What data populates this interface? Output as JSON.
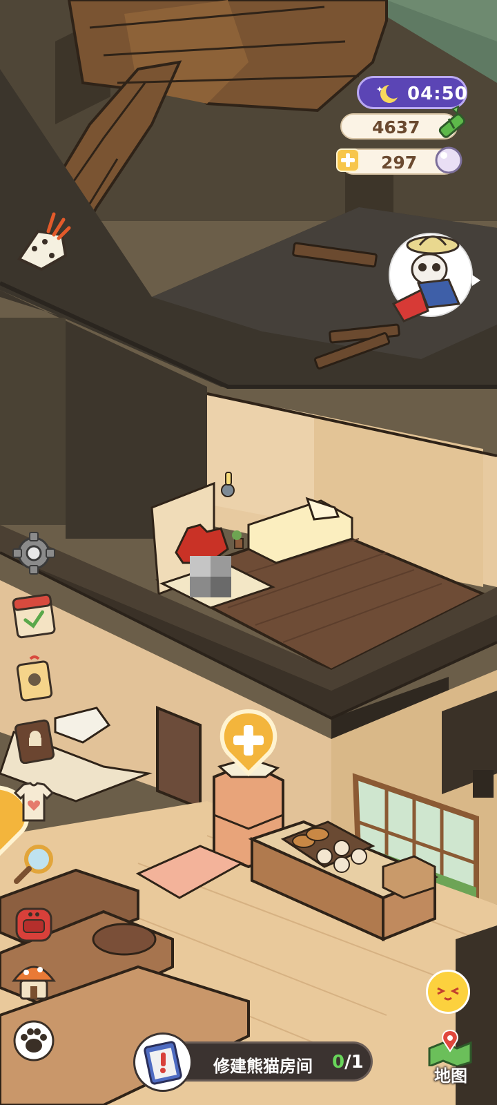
{
  "hud": {
    "time": "04:50",
    "bamboo_count": "4637",
    "pearl_count": "297"
  },
  "task": {
    "label": "修建熊猫房间",
    "done": "0",
    "total": "/1"
  },
  "map_button": {
    "label": "地图"
  },
  "sidebar": [
    {
      "icon": "settings-gear-icon"
    },
    {
      "icon": "calendar-icon"
    },
    {
      "icon": "ticket-tag-icon"
    },
    {
      "icon": "recipe-book-icon"
    },
    {
      "icon": "shirt-icon"
    },
    {
      "icon": "magnifier-icon"
    },
    {
      "icon": "backpack-icon"
    },
    {
      "icon": "mushroom-shop-icon"
    },
    {
      "icon": "paw-icon"
    }
  ],
  "colors": {
    "time_pill": "#5b45b5",
    "currency_pill": "#fbf3e5",
    "task_pill": "#3b3330",
    "progress_done": "#68d55a",
    "accent_yellow": "#f7c64b"
  }
}
